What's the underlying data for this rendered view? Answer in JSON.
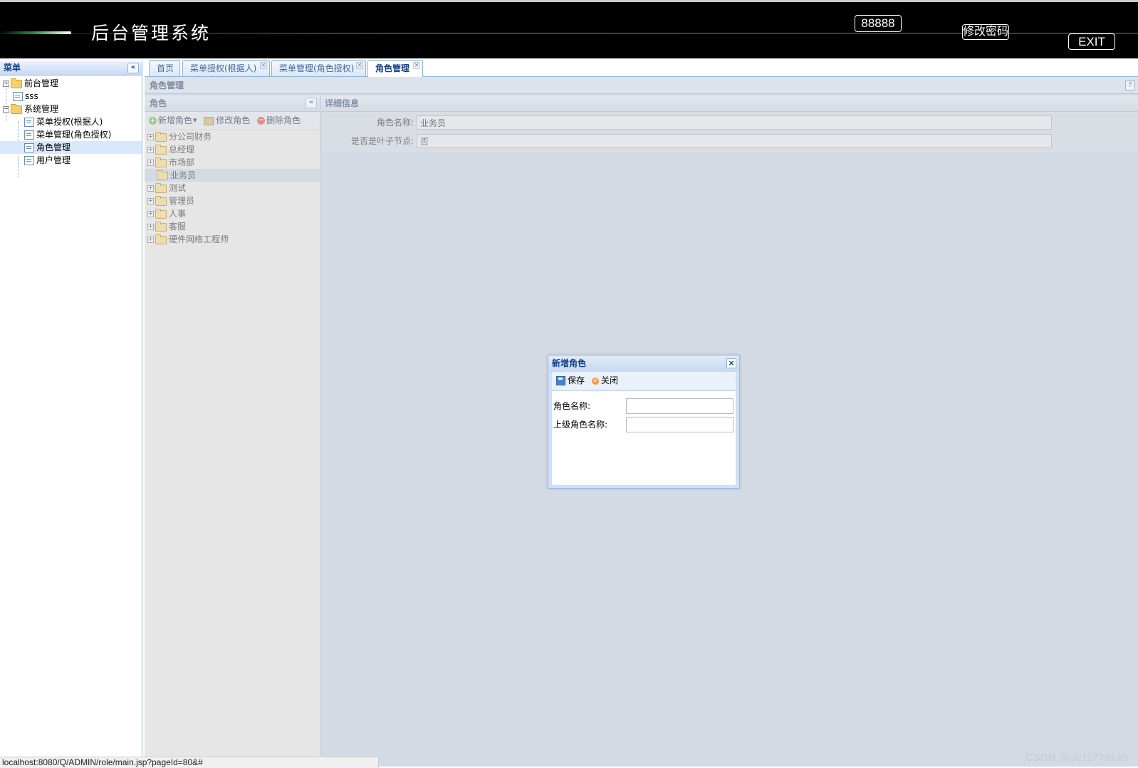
{
  "header": {
    "title": "后台管理系统",
    "user_badge": "88888",
    "change_password": "修改密码",
    "exit": "EXIT"
  },
  "menu": {
    "title": "菜单",
    "items": [
      {
        "label": "前台管理"
      },
      {
        "label": "sss"
      },
      {
        "label": "系统管理"
      },
      {
        "label": "菜单授权(根据人)"
      },
      {
        "label": "菜单管理(角色授权)"
      },
      {
        "label": "角色管理"
      },
      {
        "label": "用户管理"
      }
    ]
  },
  "tabs": [
    {
      "label": "首页"
    },
    {
      "label": "菜单授权(根据人)"
    },
    {
      "label": "菜单管理(角色授权)"
    },
    {
      "label": "角色管理",
      "active": true
    }
  ],
  "main": {
    "title": "角色管理",
    "help": "?"
  },
  "role_panel": {
    "title": "角色",
    "toolbar": {
      "add": "新增角色",
      "edit": "修改角色",
      "delete": "删除角色"
    },
    "roles": [
      {
        "label": "分公司财务"
      },
      {
        "label": "总经理"
      },
      {
        "label": "市场部"
      },
      {
        "label": "业务员",
        "selected": true
      },
      {
        "label": "测试"
      },
      {
        "label": "管理员"
      },
      {
        "label": "人事"
      },
      {
        "label": "客服"
      },
      {
        "label": "硬件网络工程师"
      }
    ]
  },
  "detail": {
    "title": "详细信息",
    "fields": [
      {
        "label": "角色名称:",
        "value": "业务员"
      },
      {
        "label": "是否是叶子节点:",
        "value": "否"
      }
    ]
  },
  "dialog": {
    "title": "新增角色",
    "save": "保存",
    "close": "关闭",
    "fields": [
      {
        "label": "角色名称:",
        "value": ""
      },
      {
        "label": "上级角色名称:",
        "value": ""
      }
    ]
  },
  "status_bar": {
    "url": "localhost:8080/Q/ADMIN/role/main.jsp?pageId=80&#"
  },
  "watermark": "CSDN @u011779145",
  "colors": {
    "header_bg": "#000000",
    "panel_border": "#99bbe8",
    "panel_title": "#15428b",
    "masked_bg": "#d3dae4"
  }
}
